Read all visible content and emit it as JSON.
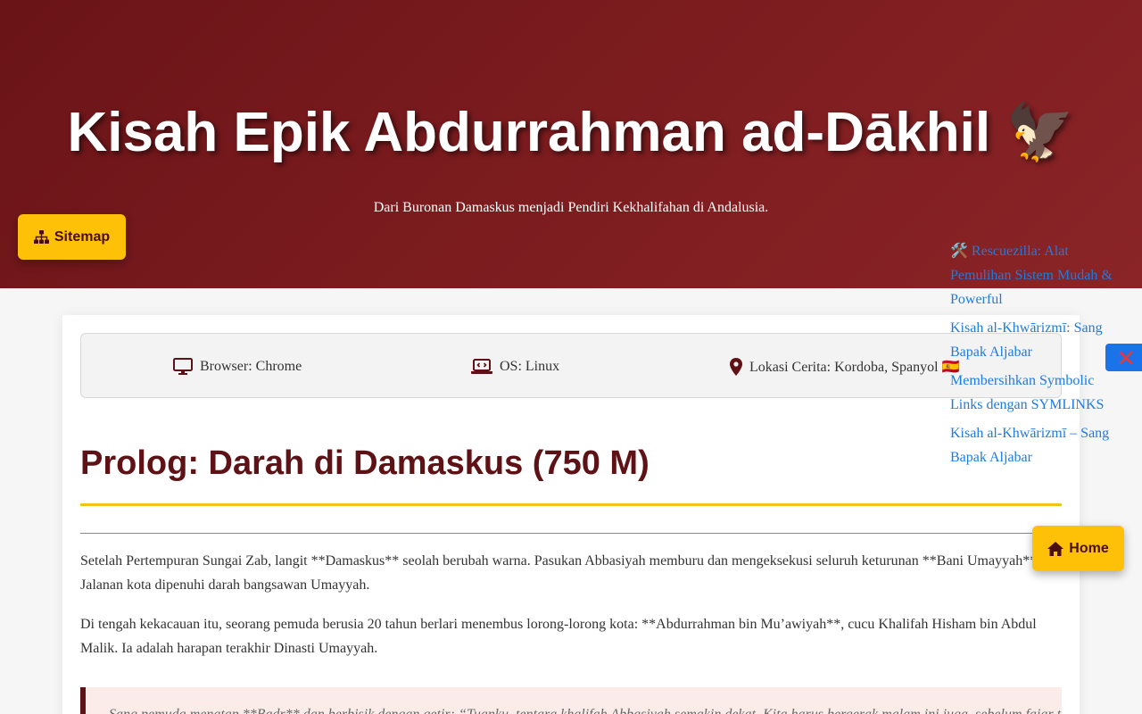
{
  "hero": {
    "title": "Kisah Epik Abdurrahman ad-Dākhil 🦅",
    "subtitle": "Dari Buronan Damaskus menjadi Pendiri Kekhalifahan di Andalusia."
  },
  "sitemap": {
    "label": "Sitemap",
    "icon": "sitemap-icon"
  },
  "info_bar": {
    "browser": "Browser: Chrome",
    "os": "OS: Linux",
    "location": "Lokasi Cerita: Kordoba, Spanyol 🇪🇸"
  },
  "article": {
    "heading": "Prolog: Darah di Damaskus (750 M)",
    "para1": "Setelah Pertempuran Sungai Zab, langit **Damaskus** seolah berubah warna. Pasukan Abbasiyah memburu dan mengeksekusi seluruh keturunan **Bani Umayyah**. Jalanan kota dipenuhi darah bangsawan Umayyah.",
    "para2": "Di tengah kekacauan itu, seorang pemuda berusia 20 tahun berlari menembus lorong-lorong kota: **Abdurrahman bin Mu’awiyah**, cucu Khalifah Hisham bin Abdul Malik. Ia adalah harapan terakhir Dinasti Umayyah.",
    "quote": "Sang pemuda menatap **Badr** dan berbisik dengan getir: “Tuanku, tentara khalifah Abbasiyah semakin dekat. Kita harus bergerak malam ini juga, sebelum fajar tiba.”"
  },
  "side_links": [
    "🛠️ Rescuezilla: Alat Pemulihan Sistem Mudah & Powerful",
    "Kisah al-Khwārizmī: Sang Bapak Aljabar",
    "Membersihkan Symbolic Links dengan SYMLINKS",
    "Kisah al-Khwārizmī – Sang Bapak Aljabar"
  ],
  "home": {
    "label": "Home",
    "icon": "home-icon"
  },
  "colors": {
    "hero": "#7c1c1f",
    "accent": "#ffc107",
    "heading": "#5e1215",
    "link": "#1e7be0",
    "close": "#1a73e8"
  }
}
